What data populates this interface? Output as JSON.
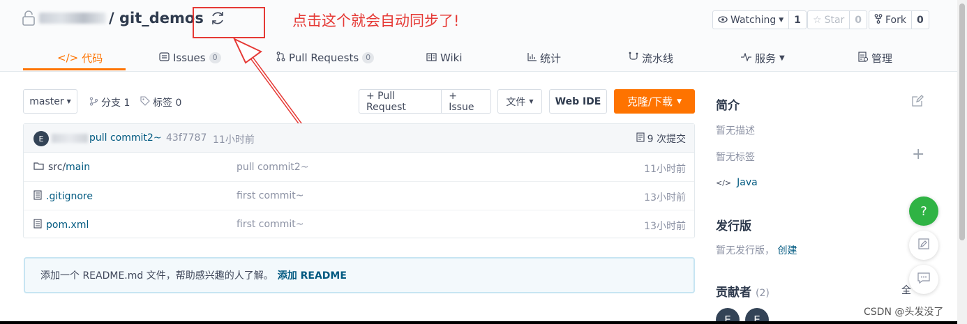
{
  "repo": {
    "separator_name": "/ git_demos"
  },
  "annotation": {
    "text": "点击这个就会自动同步了!",
    "color": "#e53935"
  },
  "header_actions": {
    "watching": {
      "label": "Watching",
      "count": "1"
    },
    "star": {
      "label": "Star",
      "count": "0"
    },
    "fork": {
      "label": "Fork",
      "count": "0"
    }
  },
  "tabs": [
    {
      "label": "代码",
      "icon": "code-icon"
    },
    {
      "label": "Issues",
      "badge": "0",
      "icon": "issues-icon"
    },
    {
      "label": "Pull Requests",
      "badge": "0",
      "icon": "pull-request-icon"
    },
    {
      "label": "Wiki",
      "icon": "book-icon"
    },
    {
      "label": "统计",
      "icon": "bar-chart-icon"
    },
    {
      "label": "流水线",
      "icon": "pipeline-icon"
    },
    {
      "label": "服务",
      "icon": "pulse-icon"
    },
    {
      "label": "管理",
      "icon": "settings-doc-icon"
    }
  ],
  "toolbar": {
    "branch": "master",
    "branches": "分支 1",
    "tags": "标签 0",
    "pull_request": "+ Pull Request",
    "issue": "+ Issue",
    "file_menu": "文件",
    "web_ide": "Web IDE",
    "clone": "克隆/下载"
  },
  "commit": {
    "avatar": "E",
    "message": "pull commit2~",
    "hash": "43f7787",
    "time": "11小时前",
    "count": "9 次提交"
  },
  "files": [
    {
      "prefix": "src/",
      "name": "main",
      "message": "pull commit2~",
      "time": "11小时前",
      "icon": "folder-icon"
    },
    {
      "prefix": "",
      "name": ".gitignore",
      "message": "first commit~",
      "time": "13小时前",
      "icon": "file-icon"
    },
    {
      "prefix": "",
      "name": "pom.xml",
      "message": "first commit~",
      "time": "13小时前",
      "icon": "file-icon"
    }
  ],
  "readme": {
    "text": "添加一个 README.md 文件，帮助感兴趣的人了解。",
    "link": "添加 README"
  },
  "sidebar": {
    "intro_title": "简介",
    "no_desc": "暂无描述",
    "no_tags": "暂无标签",
    "language": "Java",
    "release_title": "发行版",
    "no_release": "暂无发行版，",
    "create": "创建",
    "contrib_title": "贡献者",
    "contrib_count": "(2)",
    "all": "全",
    "contributors": [
      "E",
      "E"
    ]
  },
  "help_button": "?",
  "watermark": "CSDN @头发没了",
  "colors": {
    "accent": "#fe7300",
    "link": "#005980",
    "help": "#2fb344"
  }
}
